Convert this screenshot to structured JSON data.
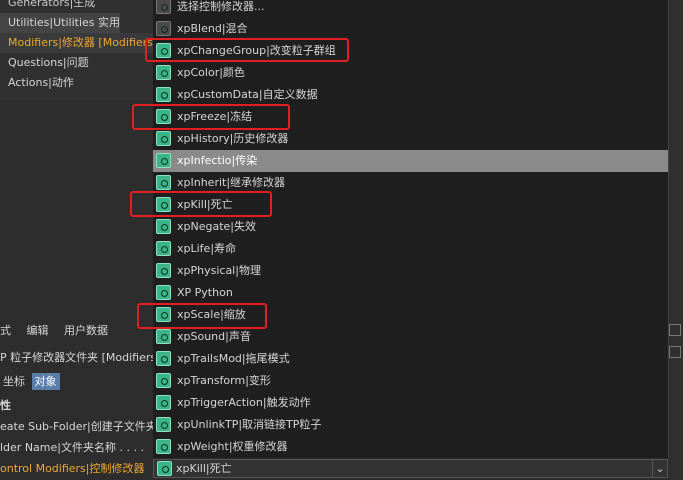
{
  "tree": {
    "items": [
      {
        "label": "Generators|生成"
      },
      {
        "label": "Utilities|Utilities 实用"
      },
      {
        "label": "Modifiers|修改器 [Modifiers]"
      },
      {
        "label": "Questions|问题"
      },
      {
        "label": "Actions|动作"
      }
    ]
  },
  "attr_panel": {
    "menu": [
      "式",
      "编辑",
      "用户数据"
    ],
    "object_title": "P 粒子修改器文件夹 [Modifiers]",
    "tabs": [
      "坐标",
      "对象"
    ],
    "section": "性",
    "create_subfolder": "eate Sub-Folder|创建子文件夹",
    "folder_name": "lder Name|文件夹名称 . . . .",
    "control_modifiers": "ontrol Modifiers|控制修改器"
  },
  "dropdown": {
    "items": [
      {
        "label": "选择控制修改器...",
        "icon": "select-icon"
      },
      {
        "label": "xpBlend|混合",
        "icon": "blend-icon"
      },
      {
        "label": "xpChangeGroup|改变粒子群组",
        "icon": "changegroup-icon"
      },
      {
        "label": "xpColor|颜色",
        "icon": "color-icon"
      },
      {
        "label": "xpCustomData|自定义数据",
        "icon": "customdata-icon"
      },
      {
        "label": "xpFreeze|冻结",
        "icon": "freeze-icon"
      },
      {
        "label": "xpHistory|历史修改器",
        "icon": "history-icon"
      },
      {
        "label": "xpInfectio|传染",
        "icon": "infection-icon"
      },
      {
        "label": "xpInherit|继承修改器",
        "icon": "inherit-icon"
      },
      {
        "label": "xpKill|死亡",
        "icon": "kill-icon"
      },
      {
        "label": "xpNegate|失效",
        "icon": "negate-icon"
      },
      {
        "label": "xpLife|寿命",
        "icon": "life-icon"
      },
      {
        "label": "xpPhysical|物理",
        "icon": "physical-icon"
      },
      {
        "label": "XP Python",
        "icon": "python-icon"
      },
      {
        "label": "xpScale|缩放",
        "icon": "scale-icon"
      },
      {
        "label": "xpSound|声音",
        "icon": "sound-icon"
      },
      {
        "label": "xpTrailsMod|拖尾模式",
        "icon": "trailsmod-icon"
      },
      {
        "label": "xpTransform|变形",
        "icon": "transform-icon"
      },
      {
        "label": "xpTriggerAction|触发动作",
        "icon": "triggeraction-icon"
      },
      {
        "label": "xpUnlinkTP|取消链接TP粒子",
        "icon": "unlinktp-icon"
      },
      {
        "label": "xpWeight|权重修改器",
        "icon": "weight-icon"
      }
    ],
    "selected": "xpKill|死亡"
  },
  "colors": {
    "highlight": "#e02020",
    "accent": "#f0a830",
    "hover": "#8a8a8a"
  }
}
